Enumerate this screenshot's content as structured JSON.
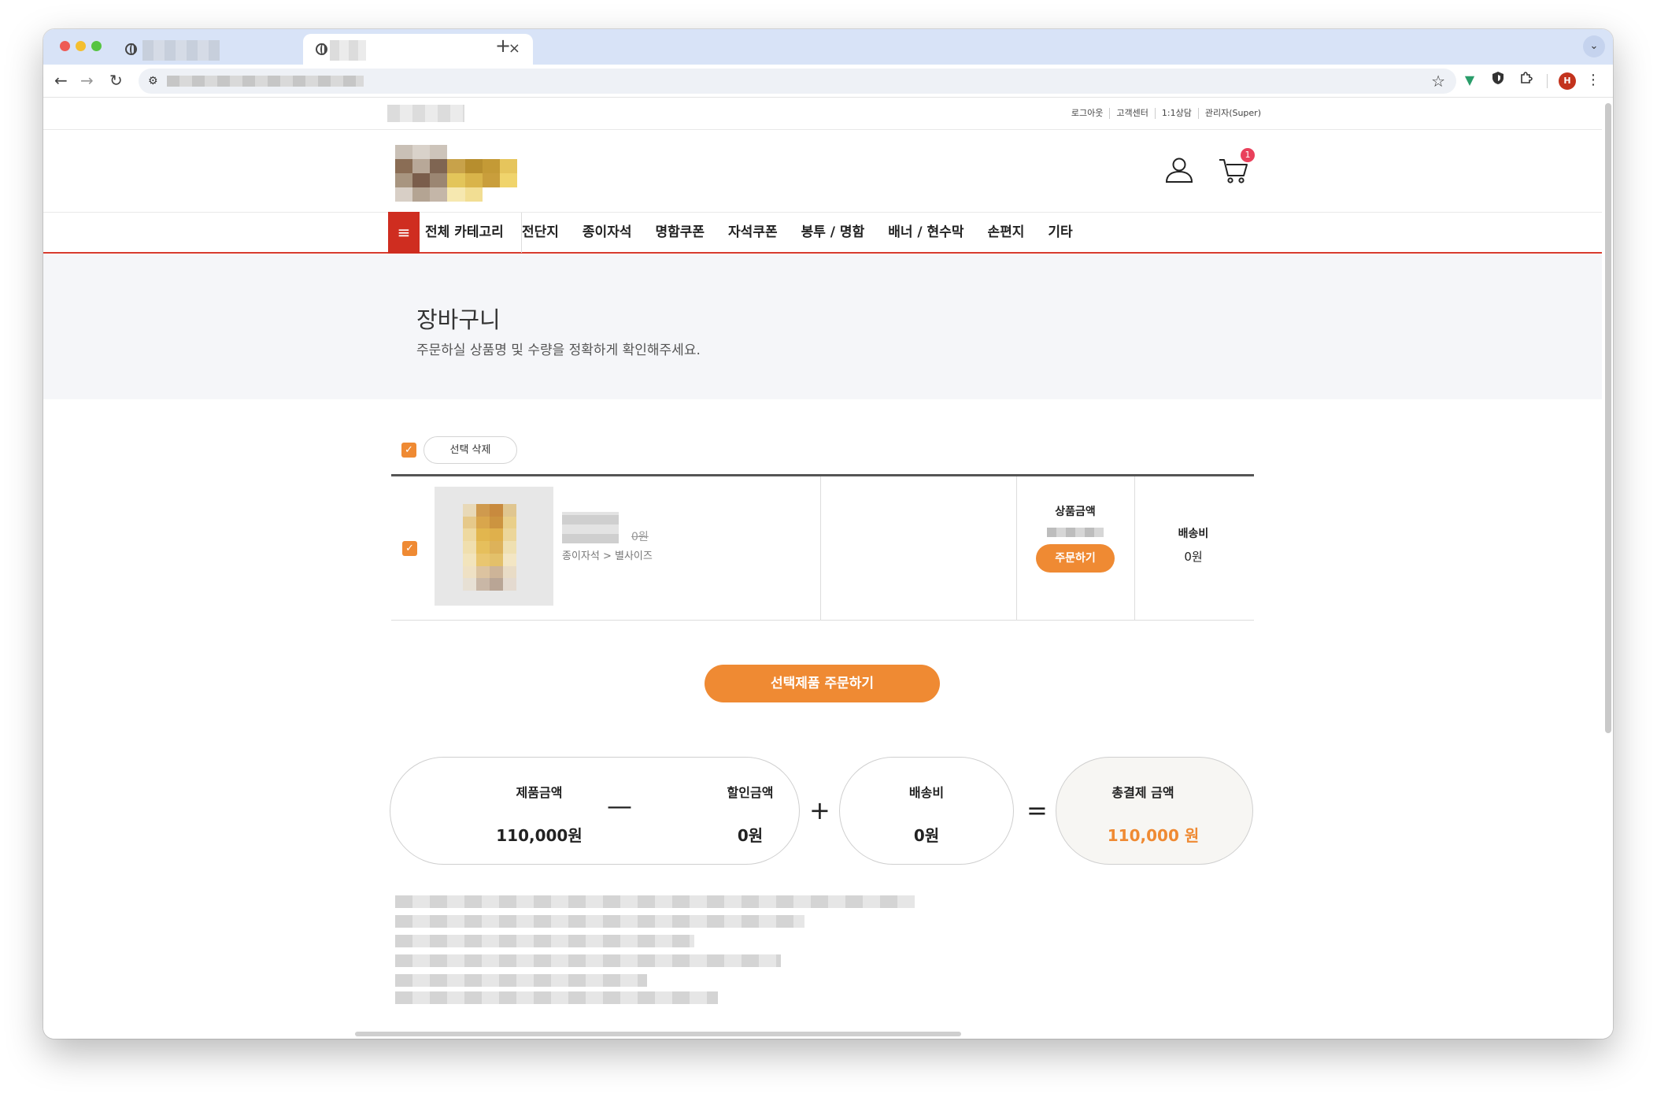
{
  "browser": {
    "new_tab_symbol": "+",
    "tab_close_symbol": "×",
    "tab_menu_symbol": "⌄",
    "profile_initial": "H"
  },
  "site": {
    "utility_links": [
      "로그아웃",
      "고객센터",
      "1:1상담",
      "관리자(Super)"
    ],
    "cart_count": "1",
    "nav": {
      "all_categories": "전체 카테고리",
      "items": [
        "전단지",
        "종이자석",
        "명함쿠폰",
        "자석쿠폰",
        "봉투 / 명함",
        "배너 / 현수막",
        "손편지",
        "기타"
      ]
    }
  },
  "page": {
    "title": "장바구니",
    "subtitle": "주문하실 상품명 및 수량을 정확하게 확인해주세요."
  },
  "cart": {
    "delete_selected_label": "선택 삭제",
    "item": {
      "old_price": "0원",
      "category_path": "종이자석 > 별사이즈",
      "price_header": "상품금액",
      "order_button": "주문하기",
      "shipping_header": "배송비",
      "shipping_value": "0원"
    },
    "order_selected_label": "선택제품 주문하기"
  },
  "summary": {
    "product_amount_label": "제품금액",
    "product_amount_value": "110,000원",
    "minus": "—",
    "discount_label": "할인금액",
    "discount_value": "0원",
    "plus": "+",
    "shipping_label": "배송비",
    "shipping_value": "0원",
    "equals": "=",
    "total_label": "총결제 금액",
    "total_value": "110,000 원"
  },
  "colors": {
    "accent": "#ef8a33",
    "nav_red": "#cf2d20",
    "badge": "#e9405b"
  }
}
